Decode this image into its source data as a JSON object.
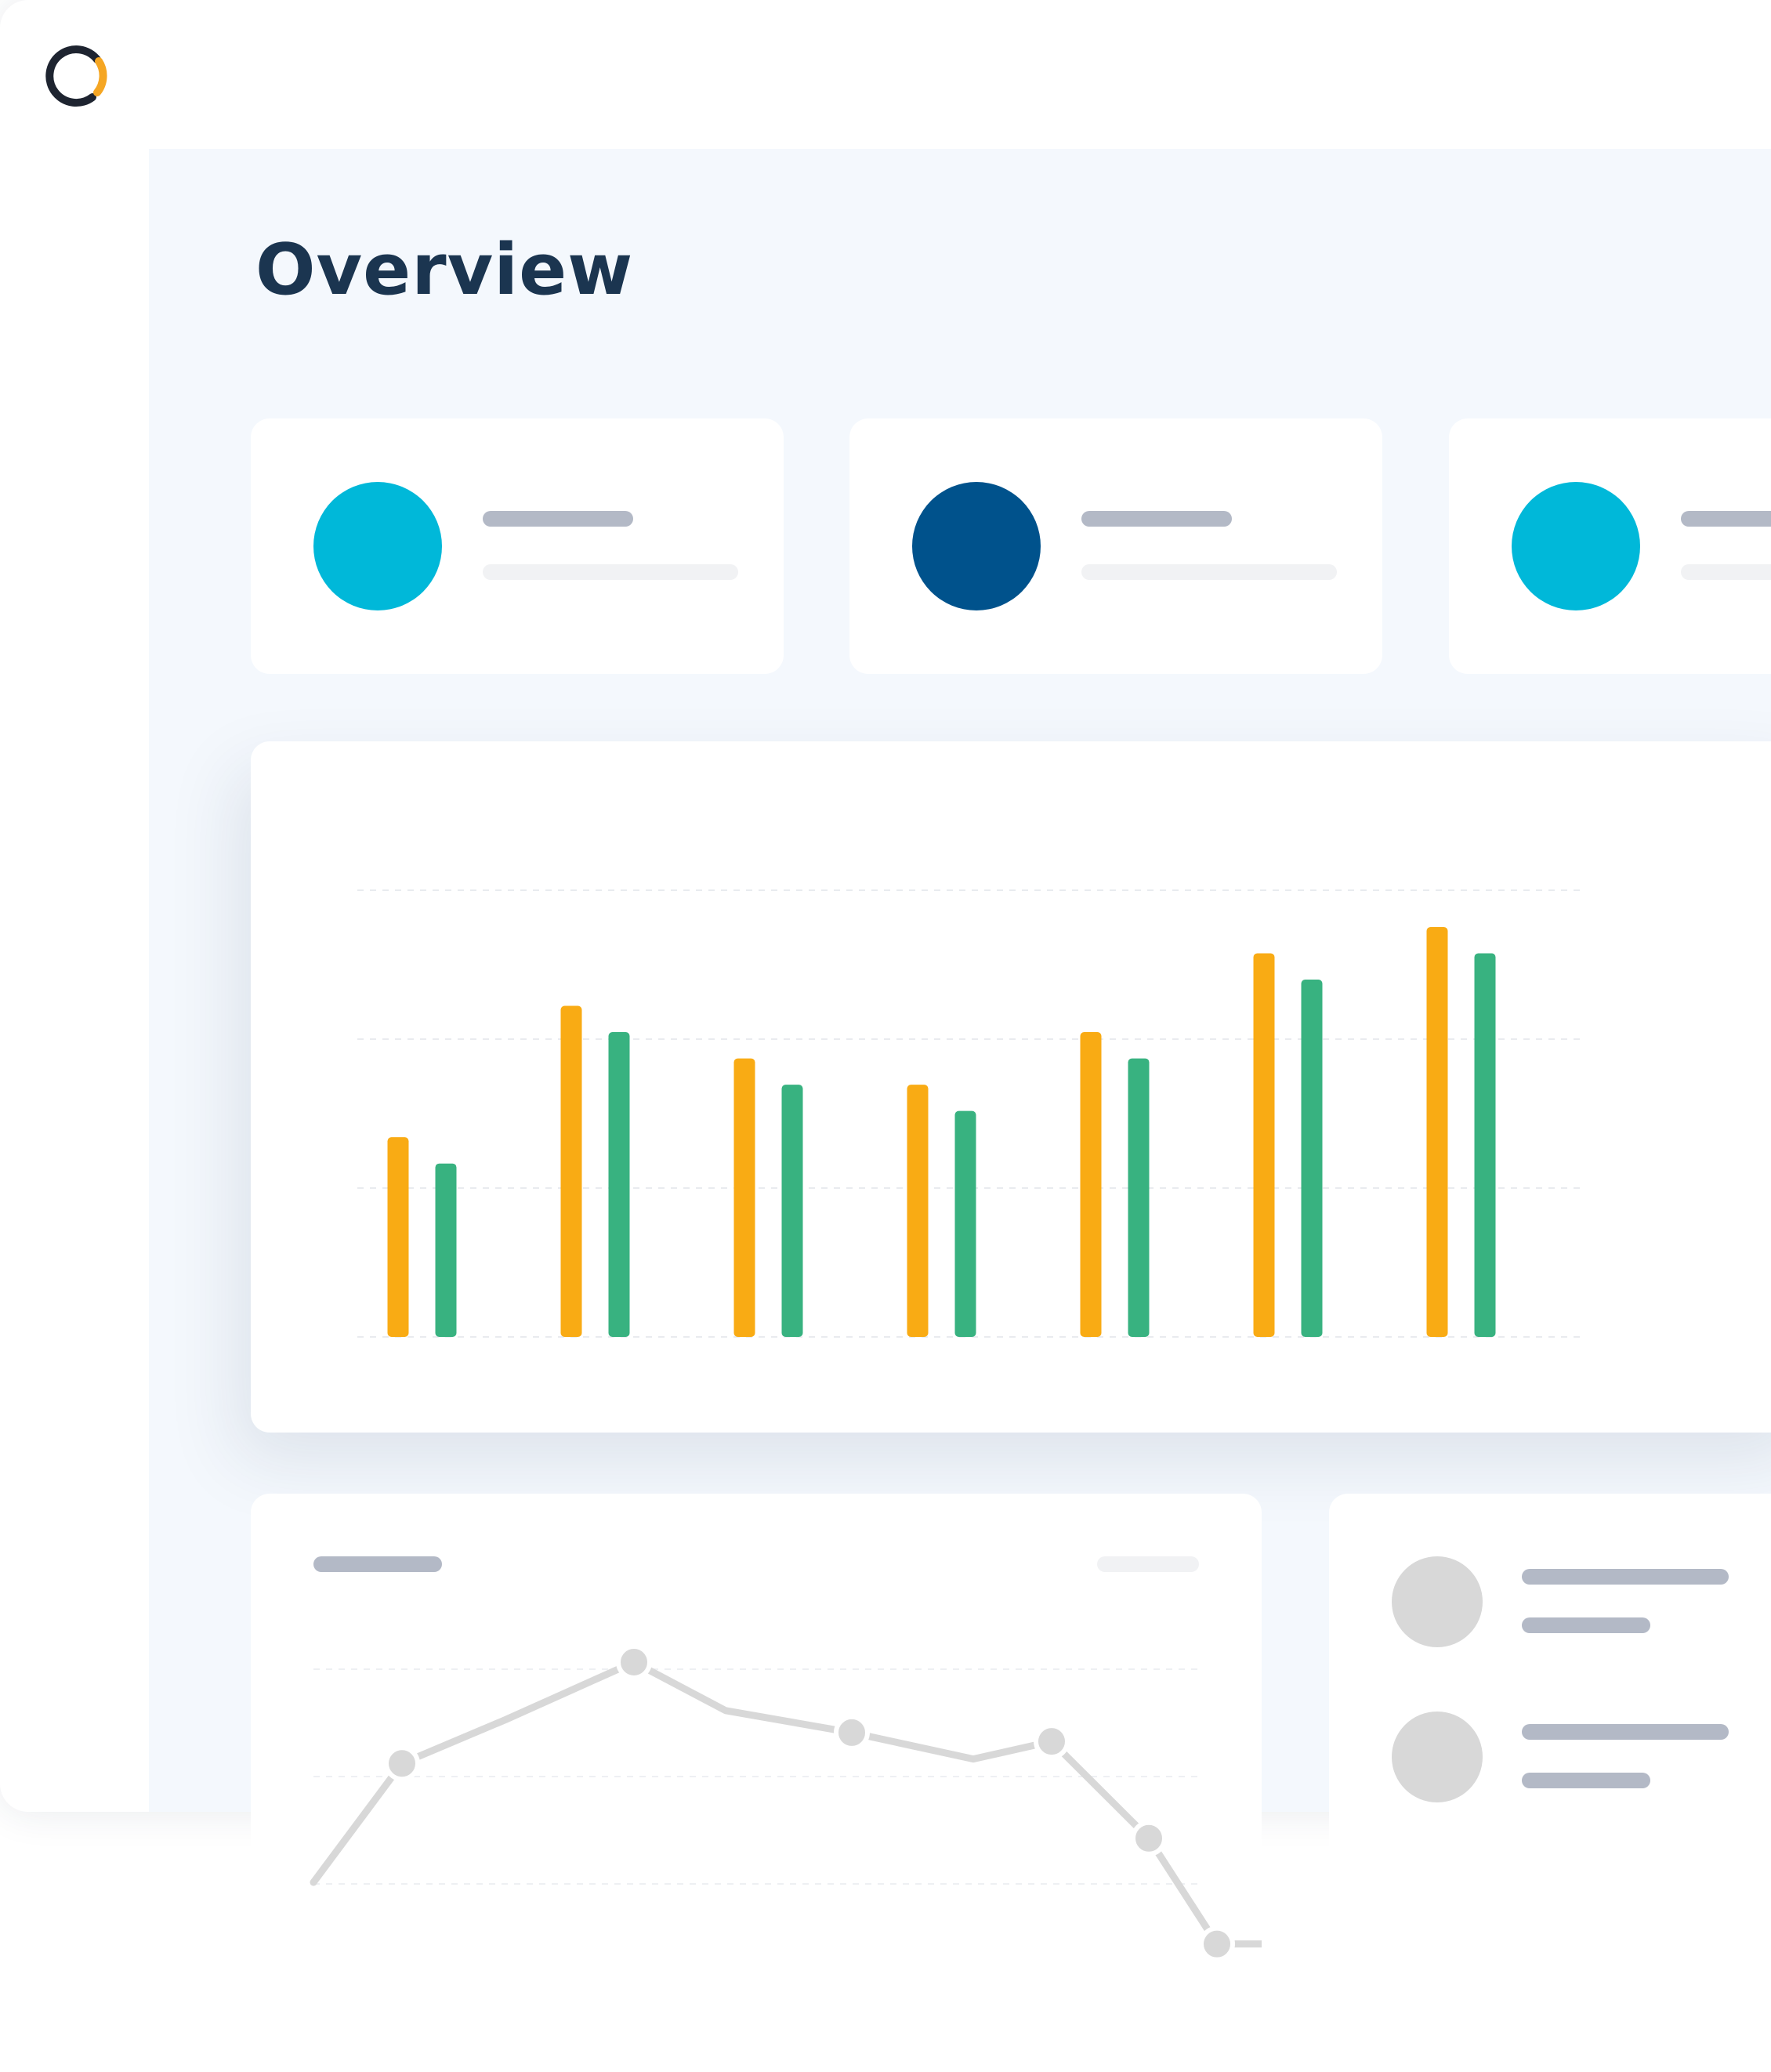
{
  "page": {
    "title": "Overview"
  },
  "icons": {
    "logo": "logo-ring-icon"
  },
  "colors": {
    "title": "#1b3550",
    "background": "#f4f8fd",
    "card": "#ffffff",
    "accent_cyan": "#00b8d9",
    "accent_navy": "#00528c",
    "series_orange": "#f9ab14",
    "series_green": "#38b280",
    "placeholder_dark": "#b3b9c6",
    "placeholder_light": "#f1f2f4",
    "placeholder_gray": "#d8d8d8"
  },
  "stat_cards": [
    {
      "dot_color": "#00b8d9"
    },
    {
      "dot_color": "#00528c"
    },
    {
      "dot_color": "#00b8d9"
    }
  ],
  "chart_data": [
    {
      "type": "bar",
      "categories": [
        "",
        "",
        "",
        "",
        "",
        "",
        ""
      ],
      "series": [
        {
          "color": "#f9ab14",
          "values": [
            38,
            63,
            53,
            48,
            58,
            73,
            78
          ]
        },
        {
          "color": "#38b280",
          "values": [
            33,
            58,
            48,
            43,
            53,
            68,
            73
          ]
        }
      ],
      "ylim": [
        0,
        85
      ],
      "grid": true
    },
    {
      "type": "line",
      "x": [
        1,
        2,
        3,
        4,
        5,
        6,
        7,
        8,
        9,
        10,
        11,
        12
      ],
      "series": [
        {
          "color": "#d8d8d8",
          "values": [
            0,
            27,
            37,
            50,
            39,
            34,
            28,
            32,
            10,
            -14,
            -14,
            2
          ]
        }
      ],
      "markers": [
        1,
        3,
        5,
        7,
        8,
        9,
        10,
        11
      ],
      "ylim": [
        -20,
        55
      ],
      "grid": true
    }
  ],
  "list_items": [
    {
      "avatar_color": "#d8d8d8"
    },
    {
      "avatar_color": "#d8d8d8"
    }
  ]
}
